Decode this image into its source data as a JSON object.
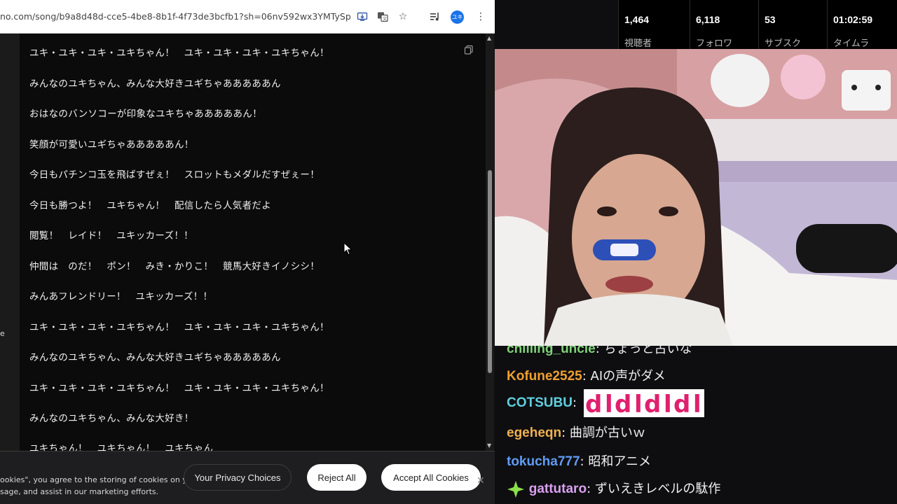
{
  "browser": {
    "url": "no.com/song/b9a8d48d-cce5-4be8-8b1f-4f73de3bcfb1?sh=06nv592wx3YMTySp",
    "profile_initials": "ユキ",
    "left_edge_text": "e",
    "lyrics": [
      "ユキ・ユキ・ユキ・ユキちゃん！　ユキ・ユキ・ユキ・ユキちゃん！",
      "みんなのユキちゃん、みんな大好きユギちゃあああああん",
      "おはなのバンソコーが印象なユキちゃあああああん！",
      "笑顔が可愛いユギちゃあああああん！",
      "今日もパチンコ玉を飛ばすぜぇ！　スロットもメダルだすぜぇー！",
      "今日も勝つよ！　ユキちゃん！　配信したら人気者だよ",
      "閲覧！　レイド！　ユキッカーズ！！",
      "仲間は　のだ！　ポン！　みき・かりこ！　競馬大好きイノシシ！",
      "みんあフレンドリー！　ユキッカーズ！！",
      "ユキ・ユキ・ユキ・ユキちゃん！　ユキ・ユキ・ユキ・ユキちゃん！",
      "みんなのユキちゃん、みんな大好きユギちゃあああああん",
      "ユキ・ユキ・ユキ・ユキちゃん！　ユキ・ユキ・ユキ・ユキちゃん！",
      "みんなのユキちゃん、みんな大好き！",
      "ユキちゃん！　ユキちゃん！　ユキちゃん"
    ],
    "cookie": {
      "text_line1": "ookies\", you agree to the storing of cookies on your device to enhance site",
      "text_line2": "sage, and assist in our marketing efforts.",
      "privacy_label": "Your Privacy Choices",
      "reject_label": "Reject All",
      "accept_label": "Accept All Cookies"
    }
  },
  "stats": [
    {
      "value": "1,464",
      "label": "視聴者"
    },
    {
      "value": "6,118",
      "label": "フォロワ"
    },
    {
      "value": "53",
      "label": "サブスク"
    },
    {
      "value": "01:02:59",
      "label": "タイムラ"
    }
  ],
  "chat": [
    {
      "user": "chilling_uncle",
      "message": "ちょっと古いな",
      "color": "#7fd37a"
    },
    {
      "user": "Kofune2525",
      "message": "AIの声がダメ",
      "color": "#f0a030"
    },
    {
      "user": "COTSUBU",
      "message": "",
      "color": "#5fd0e0",
      "emote": true
    },
    {
      "user": "egeheqn",
      "message": "曲調が古いｗ",
      "color": "#f0b050"
    },
    {
      "user": "tokucha777",
      "message": "昭和アニメ",
      "color": "#5f9cf5"
    },
    {
      "user": "gattutaro",
      "message": "ずいえきレベルの駄作",
      "color": "#d9a0f0",
      "badge": true
    }
  ],
  "colors": {
    "chat_bg": "#0e0e10",
    "stats_bg": "#000000",
    "cookie_bg": "#1e1e20"
  }
}
